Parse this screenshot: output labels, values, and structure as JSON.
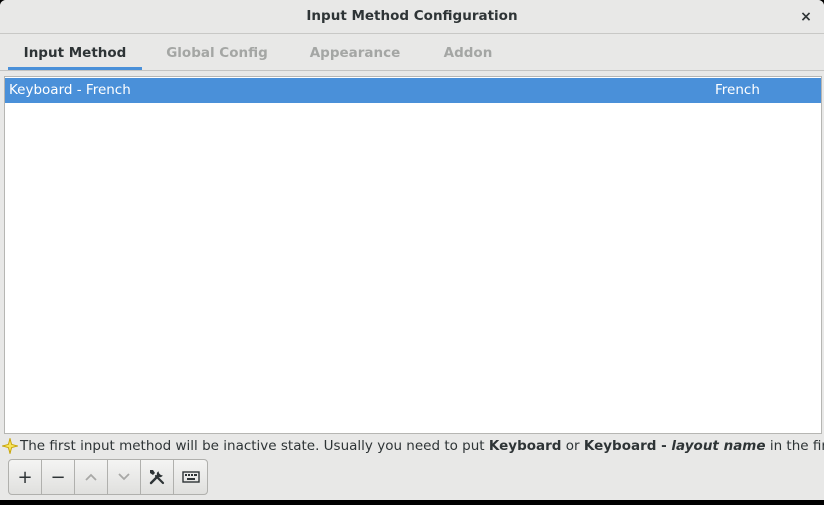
{
  "window": {
    "title": "Input Method Configuration",
    "close_label": "×"
  },
  "tabs": [
    {
      "label": "Input Method",
      "active": true
    },
    {
      "label": "Global Config",
      "active": false
    },
    {
      "label": "Appearance",
      "active": false
    },
    {
      "label": "Addon",
      "active": false
    }
  ],
  "input_methods": [
    {
      "name": "Keyboard - French",
      "language": "French",
      "selected": true
    }
  ],
  "hint": {
    "icon": "sparkle-icon",
    "text_1": "The first input method will be inactive state. Usually you need to put ",
    "bold_1": "Keyboard",
    "text_2": " or ",
    "bold_2": "Keyboard - ",
    "italic_bold": "layout name",
    "text_3": " in the first place."
  },
  "toolbar": {
    "buttons": [
      {
        "name": "add",
        "glyph": "+",
        "icon": "plus-icon",
        "enabled": true
      },
      {
        "name": "remove",
        "glyph": "−",
        "icon": "minus-icon",
        "enabled": true
      },
      {
        "name": "move-up",
        "icon": "chevron-up-icon",
        "enabled": false
      },
      {
        "name": "move-down",
        "icon": "chevron-down-icon",
        "enabled": false
      },
      {
        "name": "configure",
        "icon": "tools-icon",
        "enabled": true
      },
      {
        "name": "keyboard-layout",
        "icon": "keyboard-icon",
        "enabled": true
      }
    ]
  },
  "colors": {
    "accent": "#4a90d9",
    "window_bg": "#e8e8e7",
    "text": "#2e3436",
    "inactive_tab": "#a4a6a4"
  }
}
